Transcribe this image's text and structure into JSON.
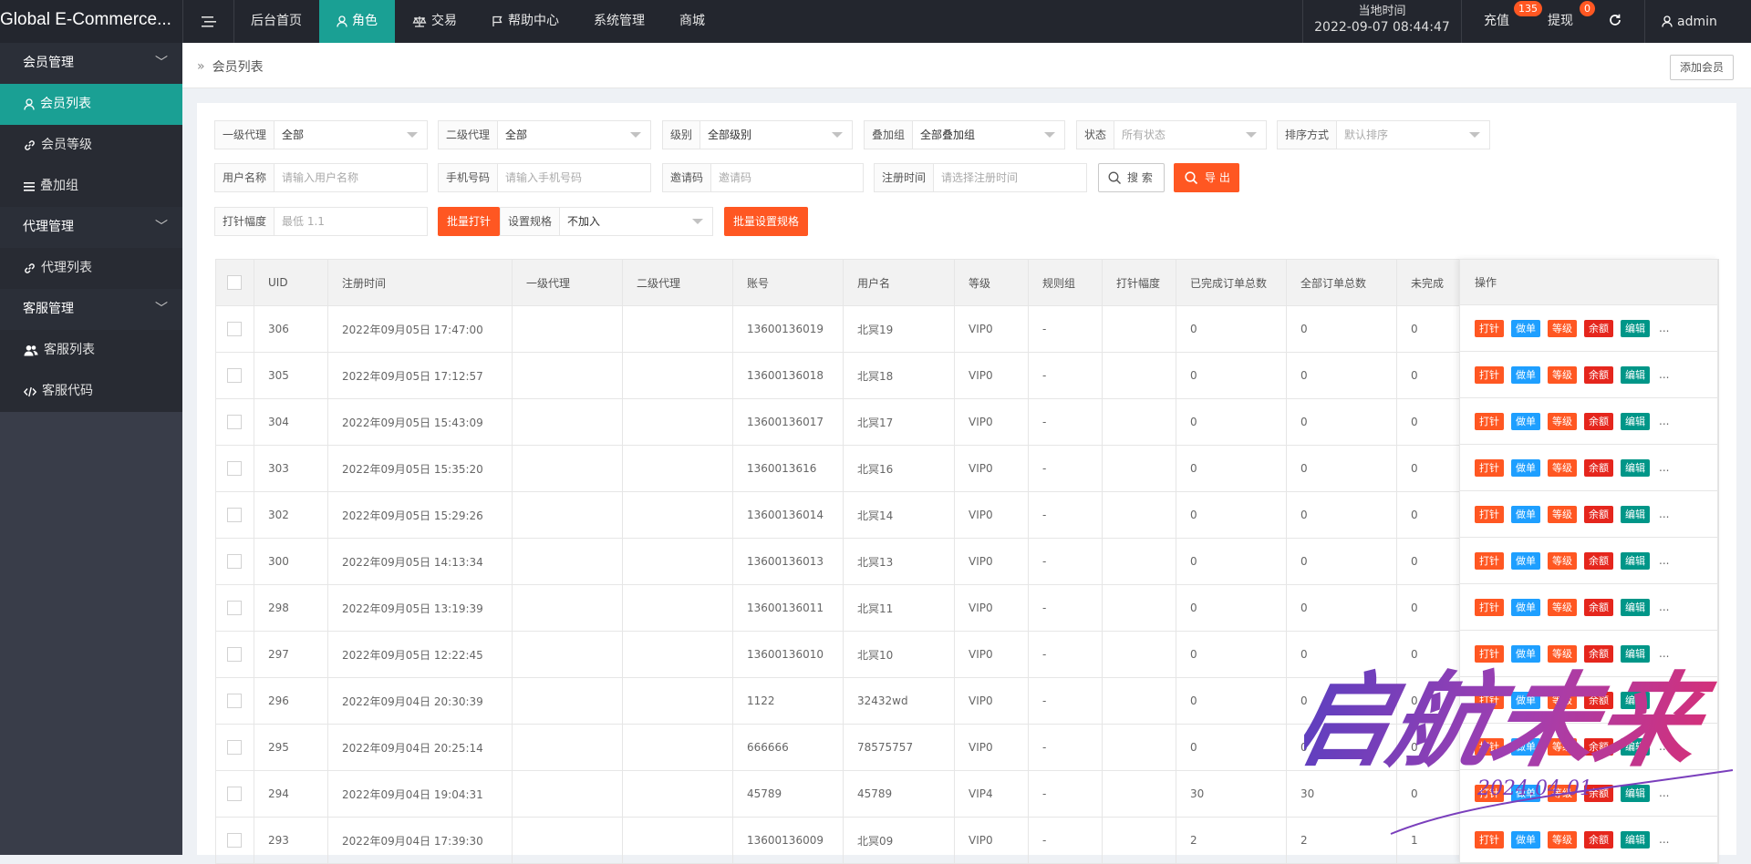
{
  "app": {
    "title": "Global E-Commerce..."
  },
  "nav": {
    "items": [
      {
        "label": "后台首页",
        "icon": ""
      },
      {
        "label": "角色",
        "icon": "user-icon"
      },
      {
        "label": "交易",
        "icon": "scale-icon"
      },
      {
        "label": "帮助中心",
        "icon": "flag-icon"
      },
      {
        "label": "系统管理",
        "icon": ""
      },
      {
        "label": "商城",
        "icon": ""
      }
    ],
    "active_index": 1
  },
  "topright": {
    "time_label": "当地时间",
    "time_value": "2022-09-07 08:44:47",
    "recharge_label": "充值",
    "recharge_badge": "135",
    "withdraw_label": "提现",
    "withdraw_badge": "0",
    "user_label": "admin"
  },
  "sidebar": {
    "groups": [
      {
        "label": "会员管理",
        "items": [
          {
            "label": "会员列表",
            "icon": "user-icon"
          },
          {
            "label": "会员等级",
            "icon": "link-icon"
          },
          {
            "label": "叠加组",
            "icon": "list-icon"
          }
        ]
      },
      {
        "label": "代理管理",
        "items": [
          {
            "label": "代理列表",
            "icon": "link-icon"
          }
        ]
      },
      {
        "label": "客服管理",
        "items": [
          {
            "label": "客服列表",
            "icon": "users-icon"
          },
          {
            "label": "客服代码",
            "icon": "code-icon"
          }
        ]
      }
    ]
  },
  "breadcrumb": {
    "current": "会员列表"
  },
  "add_member_label": "添加会员",
  "filters": {
    "level1": {
      "label": "一级代理",
      "value": "全部"
    },
    "level2": {
      "label": "二级代理",
      "value": "全部"
    },
    "grade": {
      "label": "级别",
      "value": "全部级别"
    },
    "overlay": {
      "label": "叠加组",
      "value": "全部叠加组"
    },
    "status": {
      "label": "状态",
      "placeholder": "所有状态"
    },
    "sort": {
      "label": "排序方式",
      "placeholder": "默认排序"
    },
    "username": {
      "label": "用户名称",
      "placeholder": "请输入用户名称"
    },
    "phone": {
      "label": "手机号码",
      "placeholder": "请输入手机号码"
    },
    "invite": {
      "label": "邀请码",
      "placeholder": "邀请码"
    },
    "regtime": {
      "label": "注册时间",
      "placeholder": "请选择注册时间"
    },
    "search_label": "搜 索",
    "export_label": "导 出",
    "needle": {
      "label": "打针幅度",
      "placeholder": "最低 1.1"
    },
    "batch_needle_label": "批量打针",
    "rule": {
      "label": "设置规格",
      "value": "不加入"
    },
    "batch_rule_label": "批量设置规格"
  },
  "table": {
    "headers": [
      "UID",
      "注册时间",
      "一级代理",
      "二级代理",
      "账号",
      "用户名",
      "等级",
      "规则组",
      "打针幅度",
      "已完成订单总数",
      "全部订单总数",
      "未完成"
    ],
    "ops_header": "操作",
    "op_labels": [
      "打针",
      "做单",
      "等级",
      "余额",
      "编辑"
    ],
    "more": "...",
    "rows": [
      {
        "uid": "306",
        "time": "2022年09月05日 17:47:00",
        "a1": "",
        "a2": "",
        "account": "13600136019",
        "name": "北冥19",
        "level": "VIP0",
        "rule": "-",
        "needle": "",
        "done": "0",
        "total": "0",
        "undone": "0"
      },
      {
        "uid": "305",
        "time": "2022年09月05日 17:12:57",
        "a1": "",
        "a2": "",
        "account": "13600136018",
        "name": "北冥18",
        "level": "VIP0",
        "rule": "-",
        "needle": "",
        "done": "0",
        "total": "0",
        "undone": "0"
      },
      {
        "uid": "304",
        "time": "2022年09月05日 15:43:09",
        "a1": "",
        "a2": "",
        "account": "13600136017",
        "name": "北冥17",
        "level": "VIP0",
        "rule": "-",
        "needle": "",
        "done": "0",
        "total": "0",
        "undone": "0"
      },
      {
        "uid": "303",
        "time": "2022年09月05日 15:35:20",
        "a1": "",
        "a2": "",
        "account": "1360013616",
        "name": "北冥16",
        "level": "VIP0",
        "rule": "-",
        "needle": "",
        "done": "0",
        "total": "0",
        "undone": "0"
      },
      {
        "uid": "302",
        "time": "2022年09月05日 15:29:26",
        "a1": "",
        "a2": "",
        "account": "13600136014",
        "name": "北冥14",
        "level": "VIP0",
        "rule": "-",
        "needle": "",
        "done": "0",
        "total": "0",
        "undone": "0"
      },
      {
        "uid": "300",
        "time": "2022年09月05日 14:13:34",
        "a1": "",
        "a2": "",
        "account": "13600136013",
        "name": "北冥13",
        "level": "VIP0",
        "rule": "-",
        "needle": "",
        "done": "0",
        "total": "0",
        "undone": "0"
      },
      {
        "uid": "298",
        "time": "2022年09月05日 13:19:39",
        "a1": "",
        "a2": "",
        "account": "13600136011",
        "name": "北冥11",
        "level": "VIP0",
        "rule": "-",
        "needle": "",
        "done": "0",
        "total": "0",
        "undone": "0"
      },
      {
        "uid": "297",
        "time": "2022年09月05日 12:22:45",
        "a1": "",
        "a2": "",
        "account": "13600136010",
        "name": "北冥10",
        "level": "VIP0",
        "rule": "-",
        "needle": "",
        "done": "0",
        "total": "0",
        "undone": "0"
      },
      {
        "uid": "296",
        "time": "2022年09月04日 20:30:39",
        "a1": "",
        "a2": "",
        "account": "1122",
        "name": "32432wd",
        "level": "VIP0",
        "rule": "-",
        "needle": "",
        "done": "0",
        "total": "0",
        "undone": "0"
      },
      {
        "uid": "295",
        "time": "2022年09月04日 20:25:14",
        "a1": "",
        "a2": "",
        "account": "666666",
        "name": "78575757",
        "level": "VIP0",
        "rule": "-",
        "needle": "",
        "done": "0",
        "total": "0",
        "undone": "0"
      },
      {
        "uid": "294",
        "time": "2022年09月04日 19:04:31",
        "a1": "",
        "a2": "",
        "account": "45789",
        "name": "45789",
        "level": "VIP4",
        "rule": "-",
        "needle": "",
        "done": "30",
        "total": "30",
        "undone": "0"
      },
      {
        "uid": "293",
        "time": "2022年09月04日 17:39:30",
        "a1": "",
        "a2": "",
        "account": "13600136009",
        "name": "北冥09",
        "level": "VIP0",
        "rule": "-",
        "needle": "",
        "done": "2",
        "total": "2",
        "undone": "1"
      }
    ]
  },
  "colors": {
    "accent": "#1aa094",
    "orange": "#ff5722",
    "blue": "#1e9fff",
    "red": "#e5261d",
    "green": "#009688",
    "topbar": "#23262e",
    "sidebar": "#393d49"
  },
  "watermark": {
    "text": "启航未来",
    "sub": "2024.04.01"
  }
}
